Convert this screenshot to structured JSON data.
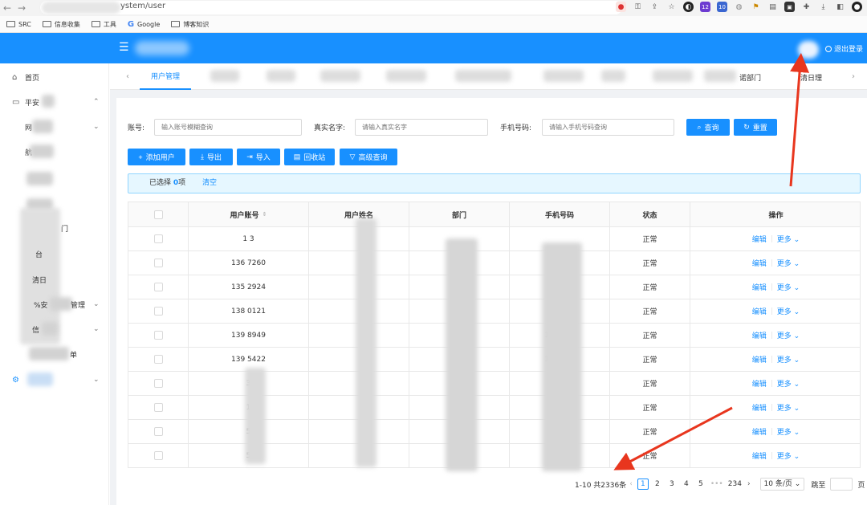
{
  "browser": {
    "url": "ystem/user",
    "bookmarks": [
      {
        "label": "SRC",
        "icon": "folder-icon"
      },
      {
        "label": "信息收集",
        "icon": "folder-icon"
      },
      {
        "label": "工具",
        "icon": "folder-icon"
      },
      {
        "label": "Google",
        "icon": "google-icon"
      },
      {
        "label": "博客知识",
        "icon": "folder-icon"
      }
    ],
    "extension_badges": [
      "12",
      "10"
    ]
  },
  "header": {
    "logout_label": "退出登录",
    "menu_icon": "menu-fold-icon"
  },
  "sidebar": {
    "items": [
      {
        "label": "首页",
        "icon": "home-icon"
      },
      {
        "label": "平安",
        "icon": "monitor-icon"
      },
      {
        "label": "网"
      },
      {
        "label": "航"
      },
      {
        "label": "门"
      },
      {
        "label": "台"
      },
      {
        "label": "清日"
      },
      {
        "label": "%安",
        "label2": "管理"
      },
      {
        "label": "信"
      },
      {
        "label": "单"
      }
    ]
  },
  "tags": {
    "active": "用户管理",
    "right_1": "诺部门",
    "right_2": "清日理"
  },
  "search": {
    "account_label": "账号:",
    "account_placeholder": "输入账号模糊查询",
    "realname_label": "真实名字:",
    "realname_placeholder": "请输入真实名字",
    "phone_label": "手机号码:",
    "phone_placeholder": "请输入手机号码查询",
    "query_label": "查询",
    "reset_label": "重置"
  },
  "toolbar": {
    "add_label": "添加用户",
    "export_label": "导出",
    "import_label": "导入",
    "recycle_label": "回收站",
    "advanced_label": "高级查询"
  },
  "selection": {
    "prefix": "已选择",
    "count": "0",
    "suffix": "项",
    "clear_label": "清空"
  },
  "table": {
    "headers": [
      "用户账号",
      "用户姓名",
      "部门",
      "手机号码",
      "状态",
      "操作"
    ],
    "rows": [
      {
        "account": "1    3",
        "phone": "",
        "status": "正常"
      },
      {
        "account": "136    7260",
        "phone": "42    0",
        "status": "正常"
      },
      {
        "account": "135    2924",
        "phone": "24",
        "status": "正常"
      },
      {
        "account": "138    0121",
        "phone": "1    121",
        "status": "正常"
      },
      {
        "account": "139    8949",
        "phone": "13    8949",
        "status": "正常"
      },
      {
        "account": "139    5422",
        "phone": "139    422",
        "status": "正常"
      },
      {
        "account": "3",
        "phone": "15    55",
        "status": "正常"
      },
      {
        "account": "1",
        "phone": "18    4",
        "status": "正常"
      },
      {
        "account": "5",
        "phone": "139",
        "status": "正常"
      },
      {
        "account": "5",
        "phone": "139    2",
        "status": "正常"
      }
    ],
    "edit_label": "编辑",
    "more_label": "更多"
  },
  "pagination": {
    "summary": "1-10 共2336条",
    "pages": [
      "1",
      "2",
      "3",
      "4",
      "5",
      "•••",
      "234"
    ],
    "current": "1",
    "page_size": "10 条/页",
    "jump_label": "跳至",
    "page_suffix": "页"
  },
  "colors": {
    "primary": "#1890ff",
    "annotation": "#e8361e"
  }
}
